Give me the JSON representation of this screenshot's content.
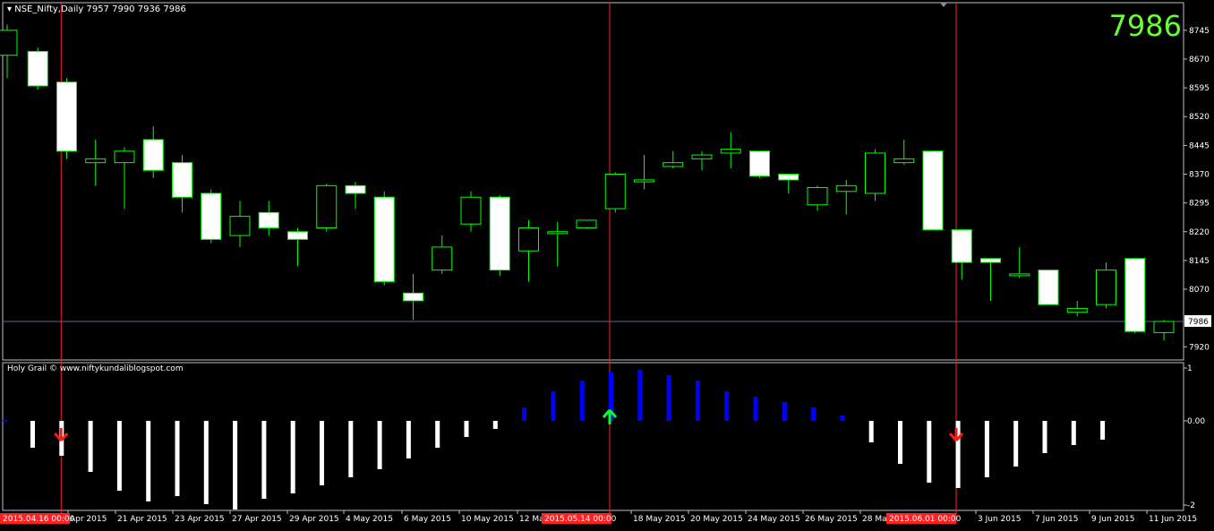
{
  "header": {
    "title": "NSE_Nifty,Daily  7957 7990 7936 7986",
    "last_price_big": "7986",
    "indicator_title": "Holy Grail © www.niftykundaliblogspot.com"
  },
  "colors": {
    "background": "#000000",
    "bull": "#00ff00",
    "bear_fill": "#ffffff",
    "grid": "#c0c0c0",
    "price_line": "#5a6a9a",
    "vline": "#ff2020",
    "ind_pos": "#0000ff",
    "ind_neg": "#ffffff",
    "arrow_down": "#ff1a1a",
    "arrow_up": "#00ff33",
    "big_price": "#66ff33"
  },
  "price_axis": {
    "ticks": [
      "8745",
      "8670",
      "8595",
      "8520",
      "8445",
      "8370",
      "8295",
      "8220",
      "8145",
      "8070",
      "7920"
    ],
    "current": "7986"
  },
  "indicator_axis": {
    "ticks": [
      "1",
      "0.00",
      "-2"
    ]
  },
  "time_axis": {
    "labels": [
      "Apr 2015",
      "21 Apr 2015",
      "23 Apr 2015",
      "27 Apr 2015",
      "29 Apr 2015",
      "4 May 2015",
      "6 May 2015",
      "10 May 2015",
      "12 Ma",
      "18 May 2015",
      "20 May 2015",
      "24 May 2015",
      "26 May 2015",
      "28 Ma",
      "3 Jun 2015",
      "7 Jun 2015",
      "9 Jun 2015",
      "11 Jun 2015"
    ],
    "highlighted": [
      "2015.04.16 00:00",
      "2015.05.14 00:00",
      "2015.06.01 00:00"
    ]
  },
  "chart_data": {
    "type": "candlestick",
    "title": "NSE_Nifty,Daily",
    "ylim": [
      7895,
      8775
    ],
    "candles": [
      {
        "o": 8680,
        "h": 8760,
        "l": 8620,
        "c": 8745
      },
      {
        "o": 8690,
        "h": 8700,
        "l": 8590,
        "c": 8600
      },
      {
        "o": 8610,
        "h": 8620,
        "l": 8410,
        "c": 8430
      },
      {
        "o": 8400,
        "h": 8460,
        "l": 8340,
        "c": 8410
      },
      {
        "o": 8400,
        "h": 8440,
        "l": 8280,
        "c": 8430
      },
      {
        "o": 8460,
        "h": 8495,
        "l": 8360,
        "c": 8380
      },
      {
        "o": 8400,
        "h": 8420,
        "l": 8270,
        "c": 8310
      },
      {
        "o": 8320,
        "h": 8330,
        "l": 8190,
        "c": 8200
      },
      {
        "o": 8210,
        "h": 8300,
        "l": 8180,
        "c": 8260
      },
      {
        "o": 8270,
        "h": 8300,
        "l": 8210,
        "c": 8230
      },
      {
        "o": 8220,
        "h": 8230,
        "l": 8130,
        "c": 8200
      },
      {
        "o": 8230,
        "h": 8345,
        "l": 8220,
        "c": 8340
      },
      {
        "o": 8340,
        "h": 8350,
        "l": 8280,
        "c": 8320
      },
      {
        "o": 8310,
        "h": 8325,
        "l": 8080,
        "c": 8090
      },
      {
        "o": 8060,
        "h": 8110,
        "l": 7990,
        "c": 8040
      },
      {
        "o": 8120,
        "h": 8210,
        "l": 8110,
        "c": 8180
      },
      {
        "o": 8240,
        "h": 8325,
        "l": 8220,
        "c": 8310
      },
      {
        "o": 8310,
        "h": 8315,
        "l": 8105,
        "c": 8120
      },
      {
        "o": 8170,
        "h": 8250,
        "l": 8090,
        "c": 8230
      },
      {
        "o": 8215,
        "h": 8245,
        "l": 8130,
        "c": 8220
      },
      {
        "o": 8230,
        "h": 8250,
        "l": 8230,
        "c": 8250
      },
      {
        "o": 8280,
        "h": 8375,
        "l": 8270,
        "c": 8370
      },
      {
        "o": 8350,
        "h": 8420,
        "l": 8330,
        "c": 8355
      },
      {
        "o": 8390,
        "h": 8430,
        "l": 8385,
        "c": 8400
      },
      {
        "o": 8410,
        "h": 8430,
        "l": 8380,
        "c": 8420
      },
      {
        "o": 8425,
        "h": 8480,
        "l": 8385,
        "c": 8435
      },
      {
        "o": 8430,
        "h": 8430,
        "l": 8360,
        "c": 8365
      },
      {
        "o": 8370,
        "h": 8370,
        "l": 8320,
        "c": 8355
      },
      {
        "o": 8290,
        "h": 8340,
        "l": 8275,
        "c": 8335
      },
      {
        "o": 8325,
        "h": 8355,
        "l": 8265,
        "c": 8340
      },
      {
        "o": 8320,
        "h": 8435,
        "l": 8300,
        "c": 8425
      },
      {
        "o": 8400,
        "h": 8460,
        "l": 8395,
        "c": 8410
      },
      {
        "o": 8430,
        "h": 8430,
        "l": 8225,
        "c": 8225
      },
      {
        "o": 8225,
        "h": 8225,
        "l": 8095,
        "c": 8140
      },
      {
        "o": 8150,
        "h": 8150,
        "l": 8040,
        "c": 8140
      },
      {
        "o": 8110,
        "h": 8180,
        "l": 8100,
        "c": 8110
      },
      {
        "o": 8120,
        "h": 8120,
        "l": 8030,
        "c": 8030
      },
      {
        "o": 8010,
        "h": 8040,
        "l": 8000,
        "c": 8020
      },
      {
        "o": 8030,
        "h": 8140,
        "l": 8020,
        "c": 8120
      },
      {
        "o": 8150,
        "h": 8150,
        "l": 7955,
        "c": 7960
      },
      {
        "o": 7957,
        "h": 7990,
        "l": 7936,
        "c": 7986
      }
    ],
    "indicator": {
      "name": "Holy Grail",
      "ylim": [
        -2,
        1.2
      ],
      "values": [
        0.02,
        -0.5,
        -0.65,
        -0.95,
        -1.3,
        -1.5,
        -1.4,
        -1.55,
        -1.65,
        -1.45,
        -1.35,
        -1.2,
        -1.05,
        -0.9,
        -0.7,
        -0.5,
        -0.3,
        -0.15,
        0.25,
        0.55,
        0.75,
        0.9,
        0.95,
        0.85,
        0.75,
        0.55,
        0.45,
        0.35,
        0.25,
        0.1,
        -0.4,
        -0.8,
        -1.15,
        -1.25,
        -1.05,
        -0.85,
        -0.6,
        -0.45,
        -0.35
      ]
    },
    "arrows": [
      {
        "bar": 1,
        "dir": "down"
      },
      {
        "bar": 20,
        "dir": "up"
      },
      {
        "bar": 32,
        "dir": "down"
      }
    ],
    "vlines": [
      1,
      20,
      32
    ]
  }
}
